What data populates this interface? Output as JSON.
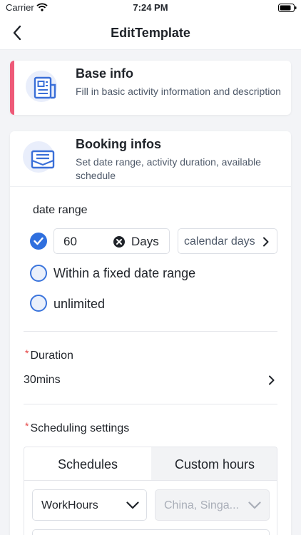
{
  "status_bar": {
    "carrier": "Carrier",
    "time": "7:24 PM"
  },
  "nav": {
    "title": "EditTemplate"
  },
  "base_info": {
    "title": "Base info",
    "description": "Fill in basic activity information and description",
    "accent_color": "#ee5a78"
  },
  "booking_infos": {
    "title": "Booking infos",
    "description": "Set date range, activity duration, available schedule"
  },
  "date_range": {
    "label": "date range",
    "days_value": "60",
    "days_unit": "Days",
    "calendar_option": "calendar days",
    "options": [
      {
        "label": "Within a fixed date range",
        "selected": false
      },
      {
        "label": "unlimited",
        "selected": false
      }
    ]
  },
  "duration": {
    "required_mark": "*",
    "label": "Duration",
    "value": "30mins"
  },
  "scheduling": {
    "required_mark": "*",
    "label": "Scheduling settings",
    "tabs": [
      "Schedules",
      "Custom hours"
    ],
    "schedule_select": "WorkHours",
    "timezone_select": "China, Singa..."
  },
  "colors": {
    "primary": "#2f6fde",
    "accent": "#ee5a78",
    "required": "#e54545"
  },
  "icons": [
    "wifi-icon",
    "battery-icon",
    "back-chevron-icon",
    "document-icon",
    "envelope-icon",
    "checkmark-icon",
    "clear-icon",
    "chevron-right-icon",
    "chevron-down-icon"
  ]
}
